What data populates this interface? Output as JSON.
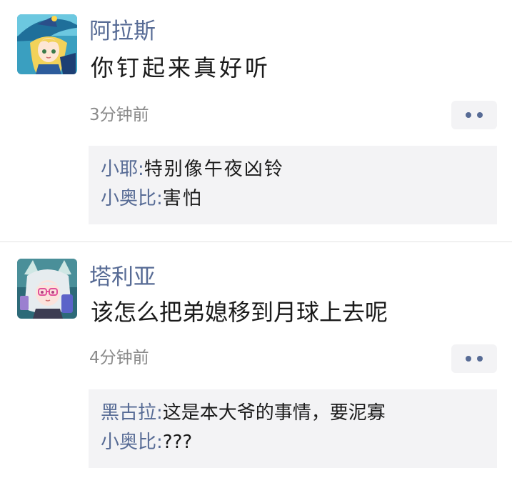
{
  "posts": [
    {
      "author": "阿拉斯",
      "content": "你钉起来真好听",
      "time": "3分钟前",
      "comments": [
        {
          "name": "小耶",
          "text": "特别像午夜凶铃"
        },
        {
          "name": "小奥比",
          "text": "害怕"
        }
      ]
    },
    {
      "author": "塔利亚",
      "content": "该怎么把弟媳移到月球上去呢",
      "time": "4分钟前",
      "comments": [
        {
          "name": "黑古拉",
          "text": "这是本大爷的事情，要泥寡"
        },
        {
          "name": "小奥比",
          "text": "???"
        }
      ]
    }
  ],
  "colon": ":",
  "colors": {
    "link": "#576b95",
    "text": "#1a1a1a",
    "meta": "#8a8a8a",
    "panel": "#f3f3f5"
  },
  "icons": {
    "avatar_1": "witch-avatar-icon",
    "avatar_2": "cat-ear-girl-avatar-icon",
    "more": "more-dots-icon"
  }
}
